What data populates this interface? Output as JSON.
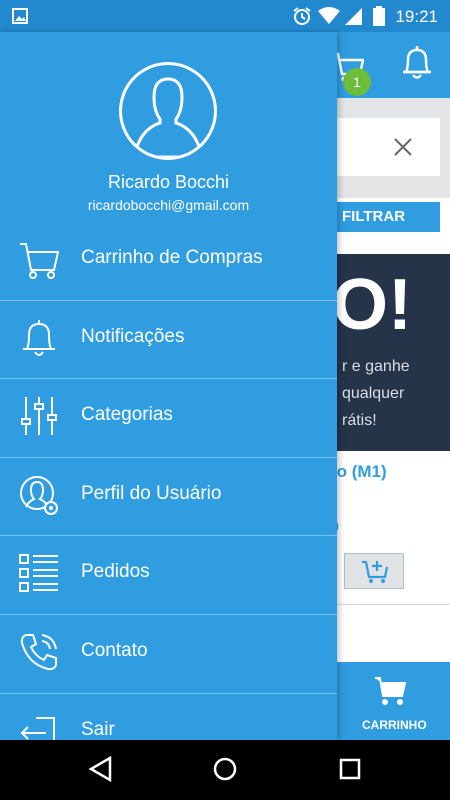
{
  "status_bar": {
    "time": "19:21"
  },
  "background": {
    "cart_badge": "1",
    "filter_label": "FILTRAR",
    "banner_big": "O!",
    "banner_lines": [
      "r e ganhe",
      "qualquer",
      "rátis!"
    ],
    "product_name": "ro (M1)",
    "product_price": "0",
    "bottom_cart_label": "CARRINHO"
  },
  "drawer": {
    "user_name": "Ricardo Bocchi",
    "user_email": "ricardobocchi@gmail.com",
    "items": [
      {
        "label": "Carrinho de Compras",
        "icon": "cart-icon"
      },
      {
        "label": "Notificações",
        "icon": "bell-icon"
      },
      {
        "label": "Categorias",
        "icon": "sliders-icon"
      },
      {
        "label": "Perfil do Usuário",
        "icon": "user-settings-icon"
      },
      {
        "label": "Pedidos",
        "icon": "list-icon"
      },
      {
        "label": "Contato",
        "icon": "phone-icon"
      },
      {
        "label": "Sair",
        "icon": "logout-icon"
      }
    ]
  },
  "colors": {
    "primary": "#2f9de0",
    "status_bar": "#2389cf",
    "badge": "#6cbd3a",
    "banner": "#263449"
  }
}
